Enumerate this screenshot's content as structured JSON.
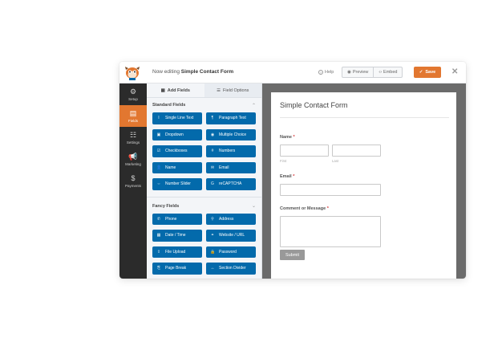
{
  "topbar": {
    "editing_prefix": "Now editing",
    "form_name": "Simple Contact Form",
    "help_label": "Help",
    "preview_label": "Preview",
    "embed_label": "Embed",
    "save_label": "Save"
  },
  "sidebar": {
    "items": [
      {
        "label": "Setup",
        "icon": "gear-icon",
        "glyph": "⚙",
        "active": false
      },
      {
        "label": "Fields",
        "icon": "fields-icon",
        "glyph": "▤",
        "active": true
      },
      {
        "label": "Settings",
        "icon": "sliders-icon",
        "glyph": "☷",
        "active": false
      },
      {
        "label": "Marketing",
        "icon": "megaphone-icon",
        "glyph": "📢",
        "active": false
      },
      {
        "label": "Payments",
        "icon": "dollar-icon",
        "glyph": "$",
        "active": false
      }
    ]
  },
  "panel": {
    "tabs": [
      {
        "label": "Add Fields",
        "glyph": "▦"
      },
      {
        "label": "Field Options",
        "glyph": "☰"
      }
    ],
    "standard_title": "Standard Fields",
    "standard_fields": [
      {
        "label": "Single Line Text",
        "glyph": "I"
      },
      {
        "label": "Paragraph Text",
        "glyph": "¶"
      },
      {
        "label": "Dropdown",
        "glyph": "▣"
      },
      {
        "label": "Multiple Choice",
        "glyph": "◉"
      },
      {
        "label": "Checkboxes",
        "glyph": "☑"
      },
      {
        "label": "Numbers",
        "glyph": "#"
      },
      {
        "label": "Name",
        "glyph": "👤"
      },
      {
        "label": "Email",
        "glyph": "✉"
      },
      {
        "label": "Number Slider",
        "glyph": "⇔"
      },
      {
        "label": "reCAPTCHA",
        "glyph": "G"
      }
    ],
    "fancy_title": "Fancy Fields",
    "fancy_fields": [
      {
        "label": "Phone",
        "glyph": "✆"
      },
      {
        "label": "Address",
        "glyph": "⚲"
      },
      {
        "label": "Date / Time",
        "glyph": "▦"
      },
      {
        "label": "Website / URL",
        "glyph": "⚭"
      },
      {
        "label": "File Upload",
        "glyph": "⇪"
      },
      {
        "label": "Password",
        "glyph": "🔒"
      },
      {
        "label": "Page Break",
        "glyph": "⎘"
      },
      {
        "label": "Section Divider",
        "glyph": "↔"
      }
    ]
  },
  "form": {
    "title": "Simple Contact Form",
    "name_label": "Name",
    "first_sublabel": "First",
    "last_sublabel": "Last",
    "email_label": "Email",
    "comment_label": "Comment or Message",
    "required_mark": "*",
    "submit_label": "Submit"
  },
  "colors": {
    "accent": "#e27730",
    "field_button": "#036aab",
    "sidebar_bg": "#2b2b2b",
    "preview_bg": "#6b6b6b"
  }
}
